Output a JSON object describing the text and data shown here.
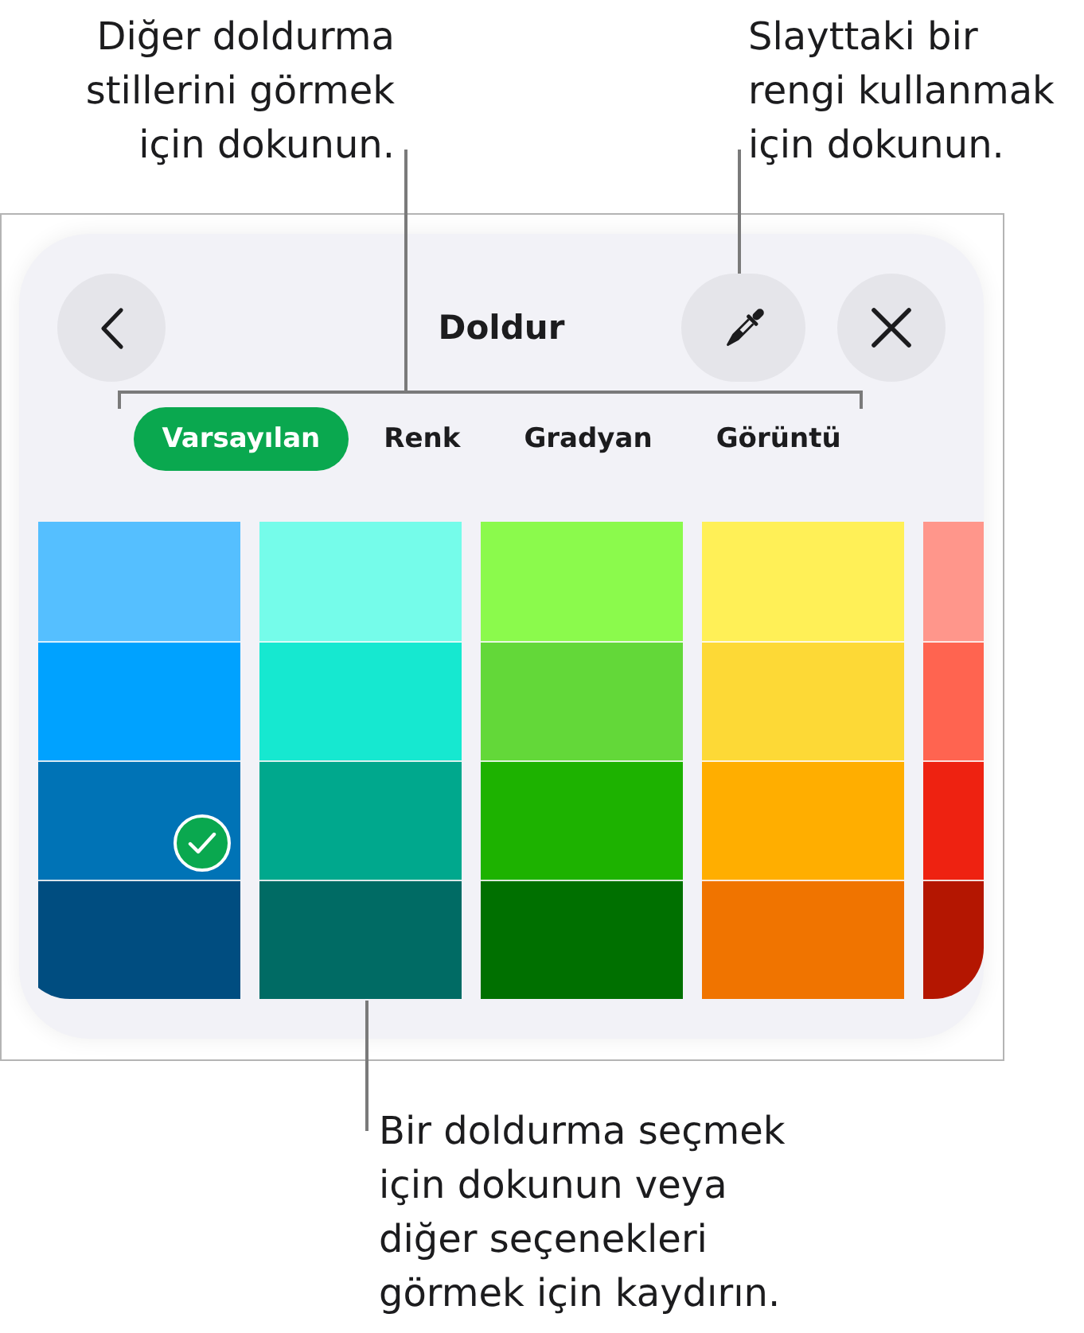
{
  "top_callouts": [
    {
      "lines": [
        "Diğer doldurma",
        "stillerini görmek",
        "için dokunun."
      ]
    },
    {
      "lines": [
        "Slayttaki bir",
        "rengi kullanmak",
        "için dokunun."
      ]
    }
  ],
  "panel": {
    "title": "Doldur",
    "tabs": [
      {
        "label": "Varsayılan",
        "selected": true
      },
      {
        "label": "Renk",
        "selected": false
      },
      {
        "label": "Gradyan",
        "selected": false
      },
      {
        "label": "Görüntü",
        "selected": false
      }
    ],
    "swatch_columns": [
      {
        "swatches": [
          {
            "color": "#55bfff",
            "selected": false
          },
          {
            "color": "#00a2ff",
            "selected": false
          },
          {
            "color": "#0073b6",
            "selected": true
          },
          {
            "color": "#004d80",
            "selected": false
          }
        ]
      },
      {
        "swatches": [
          {
            "color": "#75fcea",
            "selected": false
          },
          {
            "color": "#16e8d0",
            "selected": false
          },
          {
            "color": "#00a88d",
            "selected": false
          },
          {
            "color": "#006b64",
            "selected": false
          }
        ]
      },
      {
        "swatches": [
          {
            "color": "#8bfa4c",
            "selected": false
          },
          {
            "color": "#63d839",
            "selected": false
          },
          {
            "color": "#1db200",
            "selected": false
          },
          {
            "color": "#007000",
            "selected": false
          }
        ]
      },
      {
        "swatches": [
          {
            "color": "#fff057",
            "selected": false
          },
          {
            "color": "#fdd936",
            "selected": false
          },
          {
            "color": "#ffae00",
            "selected": false
          },
          {
            "color": "#f07400",
            "selected": false
          }
        ]
      },
      {
        "swatches": [
          {
            "color": "#ff968b",
            "selected": false
          },
          {
            "color": "#ff6450",
            "selected": false
          },
          {
            "color": "#ee2211",
            "selected": false
          },
          {
            "color": "#b41601",
            "selected": false
          }
        ]
      }
    ]
  },
  "bottom_callout": {
    "lines": [
      "Bir doldurma seçmek",
      "için dokunun veya",
      "diğer seçenekleri",
      "görmek için kaydırın."
    ]
  }
}
